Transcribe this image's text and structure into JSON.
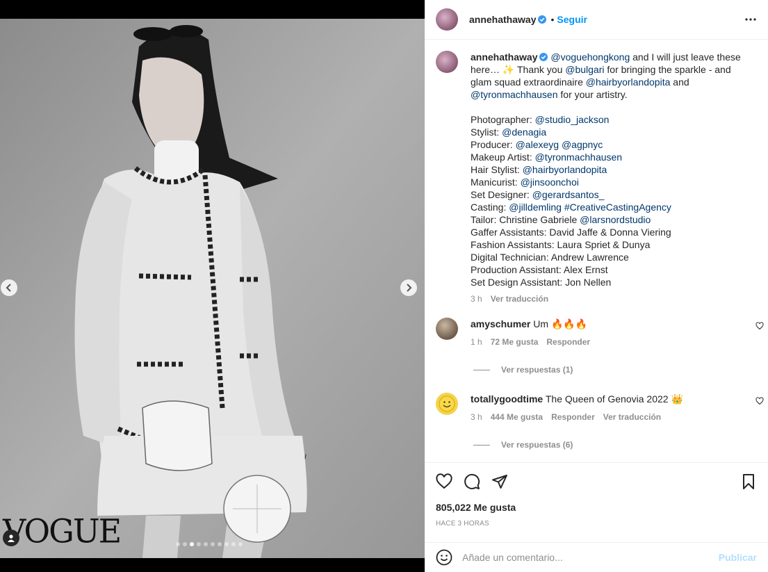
{
  "post": {
    "brand_mark": "VOGUE",
    "carousel_total": 10,
    "carousel_active_index": 2
  },
  "header": {
    "username": "annehathaway",
    "separator": "•",
    "follow_label": "Seguir"
  },
  "caption": {
    "username": "annehathaway",
    "segments": [
      {
        "t": "@voguehongkong",
        "link": true
      },
      {
        "t": " and I will just leave these here… ✨ Thank you "
      },
      {
        "t": "@bulgari",
        "link": true
      },
      {
        "t": " for bringing the sparkle - and glam squad extraordinaire "
      },
      {
        "t": "@hairbyorlandopita",
        "link": true
      },
      {
        "t": " and "
      },
      {
        "t": "@tyronmachhausen",
        "link": true
      },
      {
        "t": " for your artistry."
      }
    ],
    "credits": [
      [
        {
          "t": "Photographer: "
        },
        {
          "t": "@studio_jackson",
          "link": true
        }
      ],
      [
        {
          "t": "Stylist: "
        },
        {
          "t": "@denagia",
          "link": true
        }
      ],
      [
        {
          "t": "Producer: "
        },
        {
          "t": "@alexeyg",
          "link": true
        },
        {
          "t": " "
        },
        {
          "t": "@agpnyc",
          "link": true
        }
      ],
      [
        {
          "t": "Makeup Artist: "
        },
        {
          "t": "@tyronmachhausen",
          "link": true
        }
      ],
      [
        {
          "t": "Hair Stylist: "
        },
        {
          "t": "@hairbyorlandopita",
          "link": true
        }
      ],
      [
        {
          "t": "Manicurist: "
        },
        {
          "t": "@jinsoonchoi",
          "link": true
        }
      ],
      [
        {
          "t": "Set Designer: "
        },
        {
          "t": "@gerardsantos_",
          "link": true
        }
      ],
      [
        {
          "t": "Casting: "
        },
        {
          "t": "@jilldemling",
          "link": true
        },
        {
          "t": " "
        },
        {
          "t": "#CreativeCastingAgency",
          "link": true
        }
      ],
      [
        {
          "t": "Tailor: Christine Gabriele "
        },
        {
          "t": "@larsnordstudio",
          "link": true
        }
      ],
      [
        {
          "t": "Gaffer Assistants: David Jaffe & Donna Viering"
        }
      ],
      [
        {
          "t": "Fashion Assistants: Laura Spriet & Dunya"
        }
      ],
      [
        {
          "t": "Digital Technician: Andrew Lawrence"
        }
      ],
      [
        {
          "t": "Production Assistant: Alex Ernst"
        }
      ],
      [
        {
          "t": "Set Design Assistant: Jon Nellen"
        }
      ]
    ],
    "time": "3 h",
    "translate": "Ver traducción"
  },
  "comments": [
    {
      "username": "amyschumer",
      "text": "Um 🔥🔥🔥",
      "time": "1 h",
      "likes": "72 Me gusta",
      "reply": "Responder",
      "translate": "",
      "view_replies": "Ver respuestas (1)"
    },
    {
      "username": "totallygoodtime",
      "text": "The Queen of Genovia 2022 👑",
      "time": "3 h",
      "likes": "444 Me gusta",
      "reply": "Responder",
      "translate": "Ver traducción",
      "view_replies": "Ver respuestas (6)"
    }
  ],
  "footer": {
    "likes": "805,022 Me gusta",
    "timestamp": "HACE 3 HORAS",
    "comment_placeholder": "Añade un comentario...",
    "publish_label": "Publicar"
  },
  "colors": {
    "link": "#00376b",
    "follow": "#0095f6",
    "muted": "#8e8e8e",
    "publish_disabled": "#b3dffc"
  }
}
